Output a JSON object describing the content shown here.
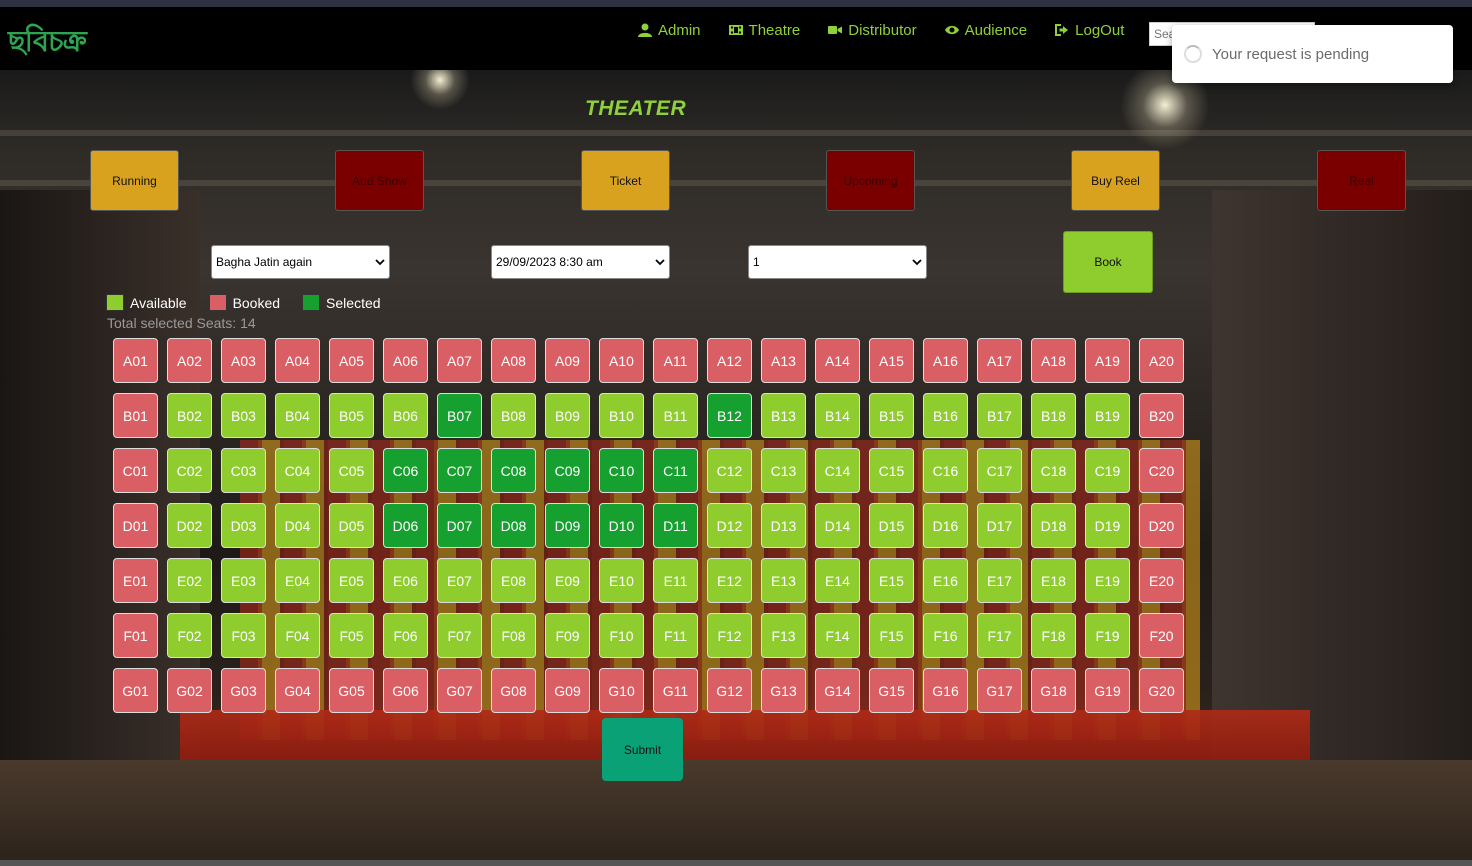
{
  "brand": "ছবিচক্র",
  "nav": [
    {
      "label": "Admin",
      "icon": "user-icon"
    },
    {
      "label": "Theatre",
      "icon": "film-icon"
    },
    {
      "label": "Distributor",
      "icon": "video-icon"
    },
    {
      "label": "Audience",
      "icon": "eye-icon"
    },
    {
      "label": "LogOut",
      "icon": "logout-icon"
    }
  ],
  "search": {
    "placeholder": "Sea"
  },
  "toast": {
    "message": "Your request is pending"
  },
  "page_title": "THEATER",
  "actions": [
    {
      "label": "Running",
      "style": "gold"
    },
    {
      "label": "Add Show",
      "style": "red"
    },
    {
      "label": "Ticket",
      "style": "gold"
    },
    {
      "label": "Upcoming",
      "style": "red"
    },
    {
      "label": "Buy Reel",
      "style": "gold"
    },
    {
      "label": "Reel",
      "style": "red"
    }
  ],
  "selects": {
    "movie": "Bagha Jatin again",
    "showtime": "29/09/2023 8:30 am",
    "screen": "1"
  },
  "book_label": "Book",
  "legend": {
    "available": "Available",
    "booked": "Booked",
    "selected": "Selected"
  },
  "total_label": "Total selected Seats: 14",
  "colors": {
    "available": "#8fcd2f",
    "booked": "#d95f65",
    "selected": "#16a02f",
    "accent": "#8fd13c",
    "submit": "#0aa176"
  },
  "seat_rows": [
    "A",
    "B",
    "C",
    "D",
    "E",
    "F",
    "G"
  ],
  "seat_count_per_row": 20,
  "seat_status": {
    "A": "bbbbbbbbbbbbbbbbbbbb",
    "B": "baaaaasaaaasaaaaaaab",
    "C": "baaaassssssaaaaaaaab",
    "D": "baaaassssssaaaaaaaab",
    "E": "baaaaaaaaaaaaaaaaaab",
    "F": "baaaaaaaaaaaaaaaaaab",
    "G": "bbbbbbbbbbbbbbbbbbbb"
  },
  "submit_label": "Submit"
}
